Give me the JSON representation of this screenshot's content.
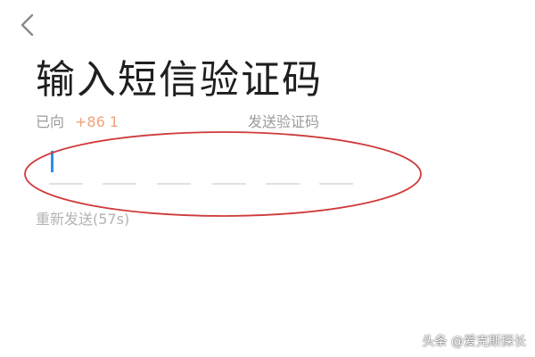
{
  "header": {
    "back_icon": "chevron-left-icon"
  },
  "title": "输入短信验证码",
  "sent_notice": {
    "prefix": "已向",
    "phone": "+86 1",
    "suffix": "发送验证码"
  },
  "code_input": {
    "slots": 6,
    "accent_color": "#2b8fe6"
  },
  "resend": {
    "label": "重新发送(57s)"
  },
  "annotation": {
    "color": "#cf3a3a"
  },
  "watermark": "头条 @爱克斯探长"
}
